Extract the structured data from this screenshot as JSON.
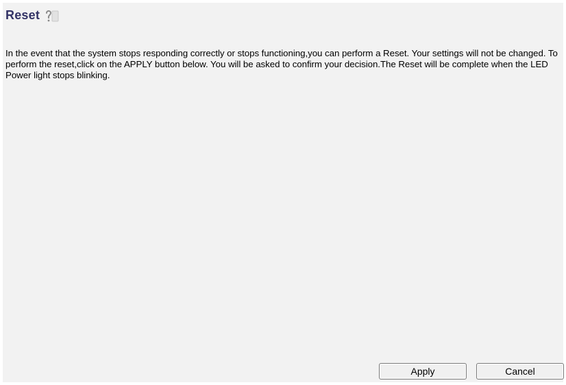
{
  "page": {
    "title": "Reset",
    "help_icon": "help-icon",
    "description": "In the event that the system stops responding correctly or stops functioning,you can perform a Reset. Your settings will not be changed. To perform the reset,click on the APPLY button below. You will be asked to confirm your decision.The Reset will be complete when the LED Power light stops blinking."
  },
  "buttons": {
    "apply_label": "Apply",
    "cancel_label": "Cancel"
  },
  "colors": {
    "title": "#333366",
    "panel_background": "#f2f2f2",
    "text": "#000000"
  }
}
